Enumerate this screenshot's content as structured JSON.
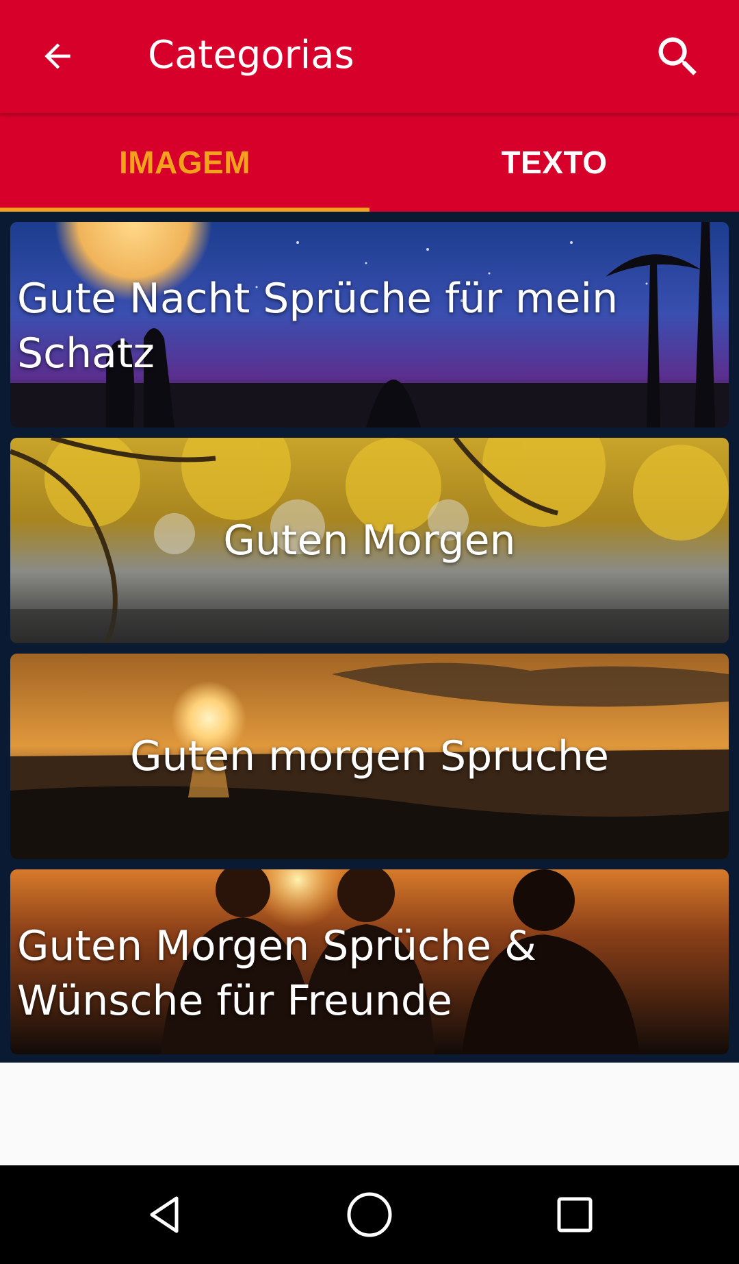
{
  "appbar": {
    "title": "Categorias",
    "back_icon": "arrow-back-icon",
    "search_icon": "search-icon",
    "background": "#d6002b"
  },
  "tabs": [
    {
      "label": "IMAGEM",
      "active": true
    },
    {
      "label": "TEXTO",
      "active": false
    }
  ],
  "accent_color": "#f2a31b",
  "categories": [
    {
      "title": "Gute Nacht Sprüche für mein Schatz",
      "image": "night-moon-couple-silhouette"
    },
    {
      "title": "Guten Morgen",
      "image": "autumn-tree-branches"
    },
    {
      "title": "Guten morgen Spruche",
      "image": "sunset-beach"
    },
    {
      "title": "Guten Morgen Sprüche & Wünsche für Freunde",
      "image": "friends-sunset-silhouette"
    }
  ],
  "navbar": {
    "back": "nav-back-icon",
    "home": "nav-home-icon",
    "recents": "nav-recents-icon"
  }
}
